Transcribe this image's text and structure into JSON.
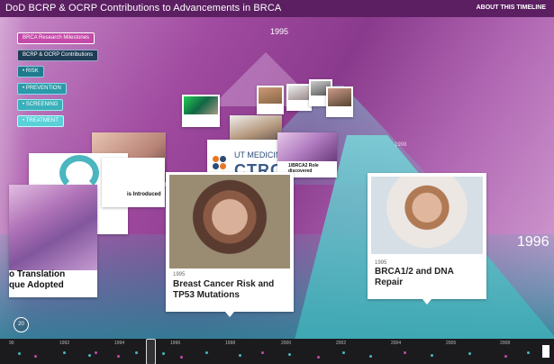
{
  "header": {
    "title": "DoD BCRP & OCRP Contributions to Advancements in BRCA",
    "about": "ABOUT THIS TIMELINE"
  },
  "year_top": "1995",
  "big_year": "1996",
  "mid_year": "1998",
  "filters": [
    {
      "label": "BRCA Research Milestones"
    },
    {
      "label": "BCRP & OCRP Contributions"
    },
    {
      "label": "• RISK"
    },
    {
      "label": "• PREVENTION"
    },
    {
      "label": "• SCREENING"
    },
    {
      "label": "• TREATMENT"
    }
  ],
  "cards": {
    "ut": {
      "line1": "UT MEDICINE",
      "line2": "CTRC"
    },
    "purple": {
      "caption": "1/BRCA2 Role\ndiscovered"
    },
    "pink2": {
      "caption": "is Introduced"
    },
    "tubes": {
      "caption": "o Translation\nque Adopted"
    },
    "main": {
      "year": "1995",
      "title": "Breast Cancer Risk and TP53 Mutations"
    },
    "right": {
      "year": "1995",
      "title": "BRCA1/2 and DNA Repair"
    }
  },
  "counter": "20",
  "timeline": {
    "years": [
      "90",
      "1992",
      "1994",
      "1996",
      "1998",
      "2000",
      "2002",
      "2004",
      "2006",
      "2008"
    ]
  },
  "colors": {
    "header_bg": "#5b1f62",
    "teal": "#4ab6c0",
    "magenta": "#c44aa9"
  }
}
